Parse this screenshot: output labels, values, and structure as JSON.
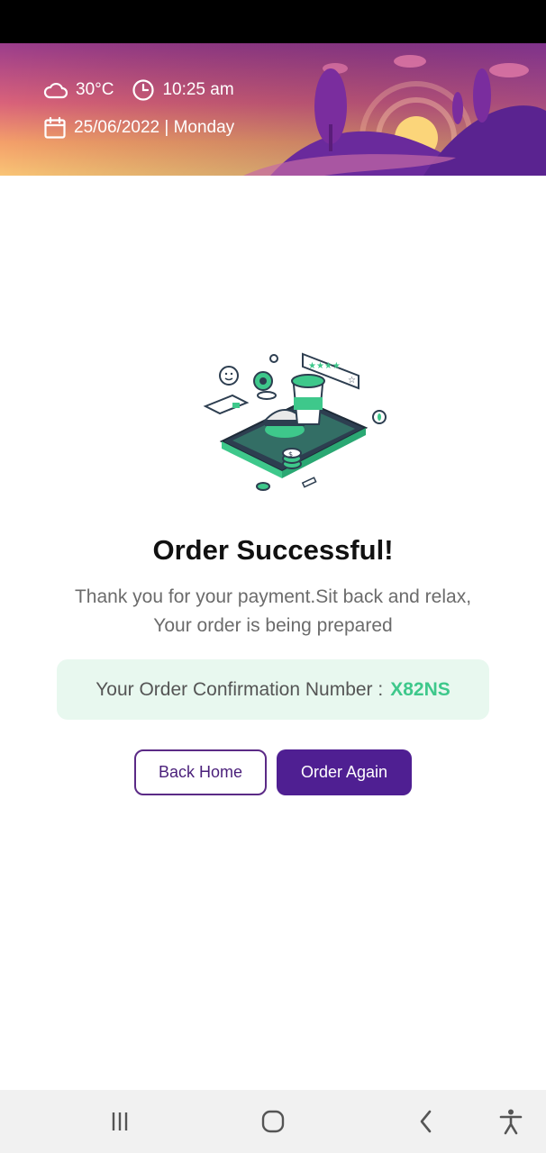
{
  "header": {
    "temperature": "30°C",
    "time": "10:25 am",
    "date": "25/06/2022 | Monday"
  },
  "order": {
    "title": "Order Successful!",
    "message_line1": "Thank you for your payment.Sit back and relax,",
    "message_line2": "Your order is being prepared",
    "confirmation_label": "Your Order Confirmation Number :",
    "confirmation_number": "X82NS"
  },
  "buttons": {
    "back_home": "Back Home",
    "order_again": "Order Again"
  },
  "nav": {
    "icons": [
      "recent-apps-icon",
      "home-icon",
      "back-icon",
      "accessibility-icon"
    ]
  },
  "colors": {
    "brand_purple": "#4f1f92",
    "success_green": "#3ec88b",
    "confirm_bg": "#e8f8ef"
  }
}
